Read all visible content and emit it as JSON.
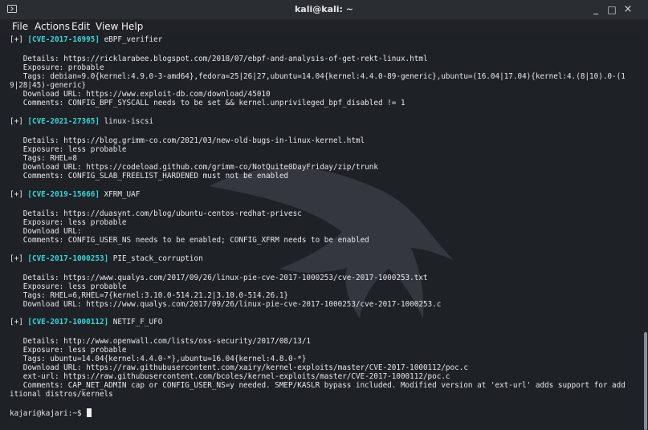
{
  "window": {
    "title": "kali@kali: ~",
    "controls": [
      "_",
      "□",
      "×"
    ]
  },
  "menu": [
    "File",
    "Actions",
    "Edit",
    "View",
    "Help"
  ],
  "entries": [
    {
      "cve": "[CVE-2017-16995]",
      "name": "eBPF_verifier",
      "details": "Details: https://ricklarabee.blogspot.com/2018/07/ebpf-and-analysis-of-get-rekt-linux.html",
      "exposure": "Exposure: probable",
      "tags1": "Tags: debian=9.0{kernel:4.9.0-3-amd64},fedora=25|26|27,ubuntu=14.04{kernel:4.4.0-89-generic},ubuntu=(16.04|17.04){kernel:4.(8|10).0-(1",
      "tags2": "9|28|45)-generic}",
      "download": "Download URL: https://www.exploit-db.com/download/45010",
      "comments": "Comments: CONFIG_BPF_SYSCALL needs to be set && kernel.unprivileged_bpf_disabled != 1"
    },
    {
      "cve": "[CVE-2021-27365]",
      "name": "linux-iscsi",
      "details": "Details: https://blog.grimm-co.com/2021/03/new-old-bugs-in-linux-kernel.html",
      "exposure": "Exposure: less probable",
      "tags": "Tags: RHEL=8",
      "download": "Download URL: https://codeload.github.com/grimm-co/NotQuite0DayFriday/zip/trunk",
      "comments": "Comments: CONFIG_SLAB_FREELIST_HARDENED must not be enabled"
    },
    {
      "cve": "[CVE-2019-15666]",
      "name": "XFRM_UAF",
      "details": "Details: https://duasynt.com/blog/ubuntu-centos-redhat-privesc",
      "exposure": "Exposure: less probable",
      "download": "Download URL:",
      "comments": "Comments: CONFIG_USER_NS needs to be enabled; CONFIG_XFRM needs to be enabled"
    },
    {
      "cve": "[CVE-2017-1000253]",
      "name": "PIE_stack_corruption",
      "details": "Details: https://www.qualys.com/2017/09/26/linux-pie-cve-2017-1000253/cve-2017-1000253.txt",
      "exposure": "Exposure: less probable",
      "tags": "Tags: RHEL=6,RHEL=7{kernel:3.10.0-514.21.2|3.10.0-514.26.1}",
      "download": "Download URL: https://www.qualys.com/2017/09/26/linux-pie-cve-2017-1000253/cve-2017-1000253.c"
    },
    {
      "cve": "[CVE-2017-1000112]",
      "name": "NETIF_F_UFO",
      "details": "Details: http://www.openwall.com/lists/oss-security/2017/08/13/1",
      "exposure": "Exposure: less probable",
      "tags": "Tags: ubuntu=14.04{kernel:4.4.0-*},ubuntu=16.04{kernel:4.8.0-*}",
      "download": "Download URL: https://raw.githubusercontent.com/xairy/kernel-exploits/master/CVE-2017-1000112/poc.c",
      "ext_url": "ext-url: https://raw.githubusercontent.com/bcoles/kernel-exploits/master/CVE-2017-1000112/poc.c",
      "comments1": "Comments: CAP_NET_ADMIN cap or CONFIG_USER_NS=y needed. SMEP/KASLR bypass included. Modified version at 'ext-url' adds support for add",
      "comments2": "itional distros/kernels"
    }
  ],
  "prompt": "kajari@kajari:~$"
}
